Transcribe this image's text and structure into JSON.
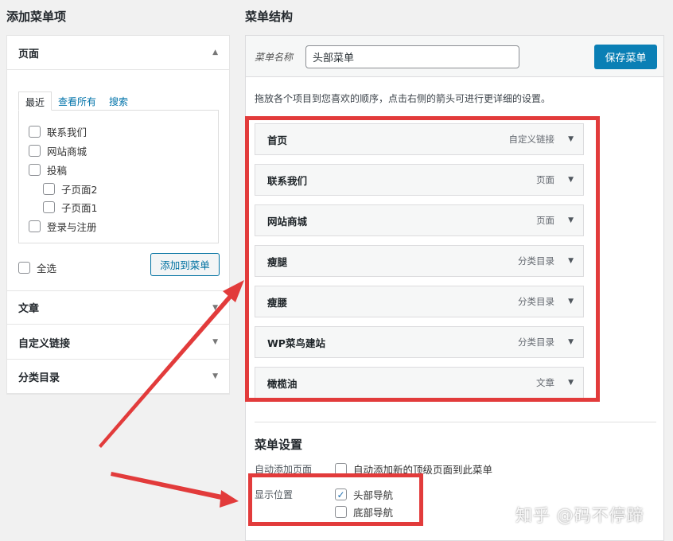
{
  "left": {
    "heading": "添加菜单项",
    "pages_section": {
      "title": "页面",
      "tabs": [
        "最近",
        "查看所有",
        "搜索"
      ],
      "items": [
        {
          "label": "联系我们",
          "checked": false,
          "indent": 0
        },
        {
          "label": "网站商城",
          "checked": false,
          "indent": 0
        },
        {
          "label": "投稿",
          "checked": false,
          "indent": 0
        },
        {
          "label": "子页面2",
          "checked": false,
          "indent": 1
        },
        {
          "label": "子页面1",
          "checked": false,
          "indent": 1
        },
        {
          "label": "登录与注册",
          "checked": false,
          "indent": 0
        }
      ],
      "select_all": "全选",
      "add_button": "添加到菜单"
    },
    "other_sections": [
      "文章",
      "自定义链接",
      "分类目录"
    ]
  },
  "right": {
    "heading": "菜单结构",
    "menu_name_label": "菜单名称",
    "menu_name_value": "头部菜单",
    "save_button": "保存菜单",
    "instructions": "拖放各个项目到您喜欢的顺序，点击右侧的箭头可进行更详细的设置。",
    "menu_items": [
      {
        "title": "首页",
        "type": "自定义链接"
      },
      {
        "title": "联系我们",
        "type": "页面"
      },
      {
        "title": "网站商城",
        "type": "页面"
      },
      {
        "title": "瘦腿",
        "type": "分类目录"
      },
      {
        "title": "瘦腰",
        "type": "分类目录"
      },
      {
        "title": "WP菜鸟建站",
        "type": "分类目录"
      },
      {
        "title": "橄榄油",
        "type": "文章"
      }
    ],
    "settings": {
      "title": "菜单设置",
      "auto_add_label": "自动添加页面",
      "auto_add_option": "自动添加新的顶级页面到此菜单",
      "location_label": "显示位置",
      "locations": [
        {
          "label": "头部导航",
          "checked": true
        },
        {
          "label": "底部导航",
          "checked": false
        }
      ]
    }
  },
  "watermark": "知乎 @码不停蹄",
  "colors": {
    "highlight": "#e23b3b",
    "primary": "#0a7fb5",
    "link": "#0073aa"
  }
}
